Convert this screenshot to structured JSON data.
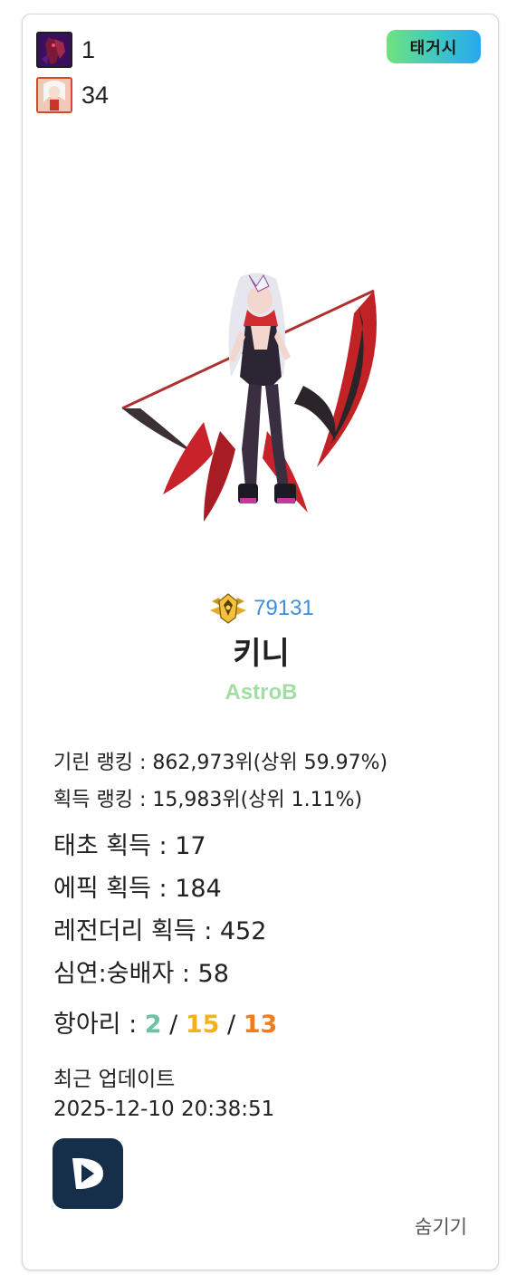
{
  "stats": [
    {
      "icon": "dark-avatar-icon",
      "value": "1"
    },
    {
      "icon": "white-hair-avatar-icon",
      "value": "34"
    }
  ],
  "tag_label": "태거시",
  "character": {
    "rank_number": "79131",
    "name": "키니",
    "guild": "AstroB"
  },
  "rankings": {
    "girin": "기린 랭킹 : 862,973위(상위 59.97%)",
    "acquire": "획득 랭킹 : 15,983위(상위 1.11%)"
  },
  "counts": {
    "taecho": "태초 획득 : 17",
    "epic": "에픽 획득 : 184",
    "legendary": "레전더리 획득 : 452",
    "simyeon": "심연:숭배자 : 58"
  },
  "jar": {
    "label": "항아리 : ",
    "a": "2",
    "b": "15",
    "c": "13",
    "sep": " / "
  },
  "update": {
    "label": "최근 업데이트",
    "timestamp": "2025-12-10 20:38:51"
  },
  "hide_label": "숨기기",
  "colors": {
    "tag_gradient": [
      "#6ee37e",
      "#2aa7ef"
    ],
    "rank_number": "#3f8fd8",
    "guild": "#a2dea4",
    "jar_a": "#6cc2a6",
    "jar_b": "#f5b01c",
    "jar_c": "#f07d1b",
    "app_button": "#152f4b"
  }
}
